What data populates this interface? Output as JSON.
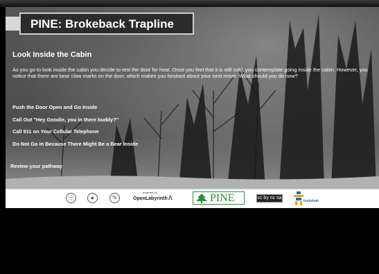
{
  "header": {
    "title": "PINE: Brokeback Trapline"
  },
  "node": {
    "title": "Look Inside the Cabin",
    "text": "As you go to look inside the cabin you decide to test the door for heat. Once you feel that it is still cold, you contemplate going inside the cabin. However, you notice that there are bear claw marks on the door, which makes you hesitant about your next move. What should you do now?"
  },
  "choices": [
    {
      "label": "Push the Door Open and Go Inside"
    },
    {
      "label": "Call Out \"Hey Goodie, you in there buddy?\""
    },
    {
      "label": "Call 911 on Your Cellular Telephone"
    },
    {
      "label": "Do Not Go In Because There Might Be a Bear Inside"
    }
  ],
  "review_link": "Review your pathway",
  "footer": {
    "openlabyrinth_tagline": "powered by",
    "openlabyrinth_name": "OpenLabyrinth",
    "pine_logo_text": "PINE",
    "cc_badge": "cc by nc sa",
    "inukshuk_label": "inukshuk",
    "icons": [
      "accessibility-icon",
      "github-icon",
      "edit-icon"
    ]
  }
}
